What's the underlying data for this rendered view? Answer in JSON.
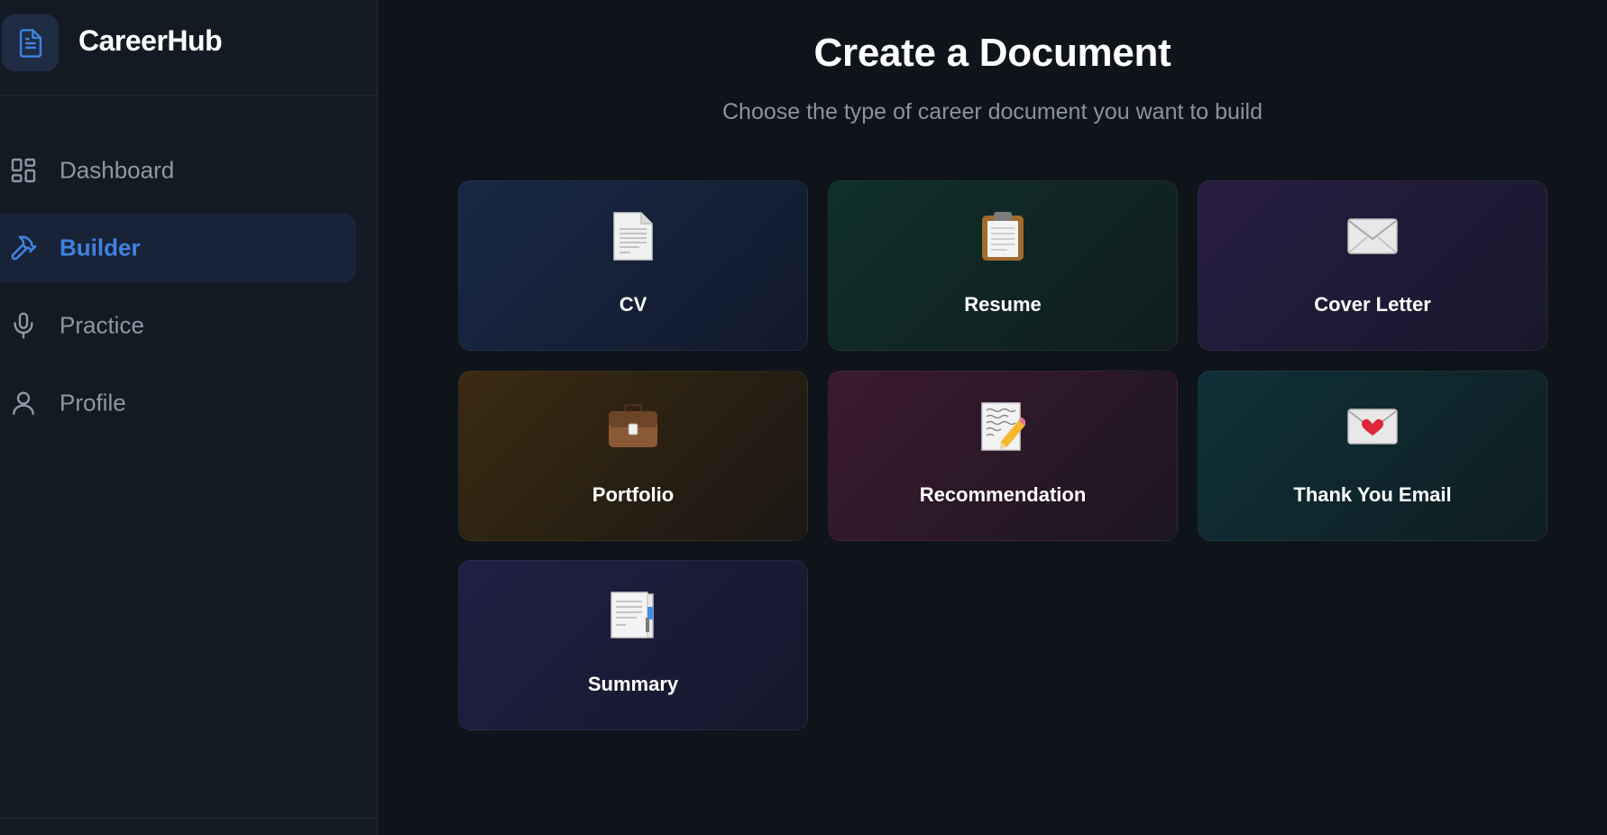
{
  "brand": {
    "name": "CareerHub",
    "icon": "document-icon"
  },
  "sidebar": {
    "items": [
      {
        "label": "Dashboard",
        "icon": "grid-icon",
        "active": false
      },
      {
        "label": "Builder",
        "icon": "hammer-icon",
        "active": true
      },
      {
        "label": "Practice",
        "icon": "microphone-icon",
        "active": false
      },
      {
        "label": "Profile",
        "icon": "user-icon",
        "active": false
      }
    ]
  },
  "main": {
    "title": "Create a Document",
    "subtitle": "Choose the type of career document you want to build",
    "documents": [
      {
        "label": "CV",
        "emoji": "📄",
        "icon": "page-icon"
      },
      {
        "label": "Resume",
        "emoji": "📋",
        "icon": "clipboard-icon"
      },
      {
        "label": "Cover Letter",
        "emoji": "✉️",
        "icon": "envelope-icon"
      },
      {
        "label": "Portfolio",
        "emoji": "💼",
        "icon": "briefcase-icon"
      },
      {
        "label": "Recommendation",
        "emoji": "📝",
        "icon": "memo-icon"
      },
      {
        "label": "Thank You Email",
        "emoji": "💌",
        "icon": "love-letter-icon"
      },
      {
        "label": "Summary",
        "emoji": "📑",
        "icon": "bookmark-tabs-icon"
      }
    ]
  },
  "colors": {
    "background": "#0f131a",
    "sidebar": "#141a24",
    "accent": "#3f82e0",
    "muted_text": "#8f97a3"
  }
}
